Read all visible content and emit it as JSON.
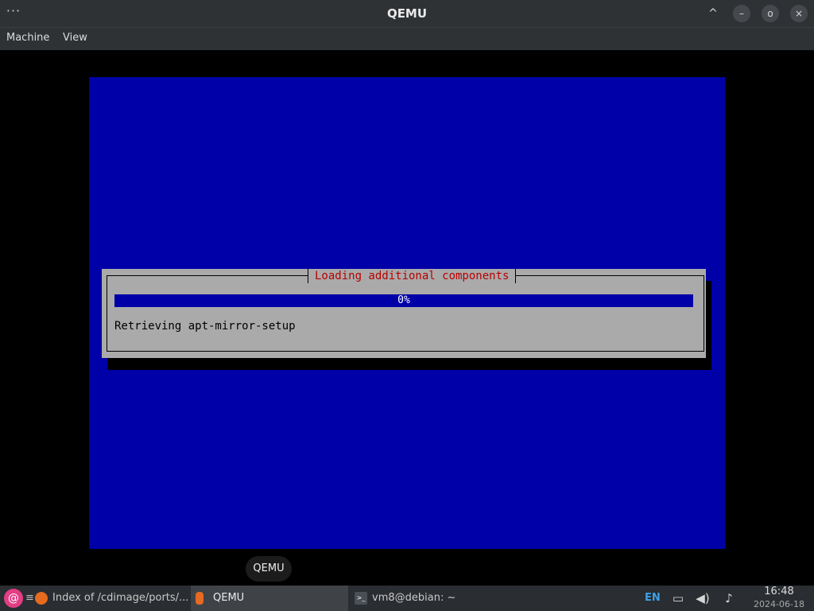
{
  "window": {
    "title": "QEMU",
    "menu_icon": "ellipsis-menu-icon",
    "controls": {
      "collapse_glyph": "^",
      "minimize_glyph": "–",
      "restore_glyph": "o",
      "close_glyph": "×"
    }
  },
  "menubar": {
    "items": [
      {
        "label": "Machine"
      },
      {
        "label": "View"
      }
    ]
  },
  "guest": {
    "background_color": "#0000a8",
    "dialog": {
      "title": "Loading additional components",
      "progress_label": "0%",
      "progress_fraction": 0,
      "status": "Retrieving apt-mirror-setup",
      "title_color": "#b80000",
      "dialog_color": "#aaaaaa"
    }
  },
  "tooltip": {
    "text": "QEMU"
  },
  "taskbar": {
    "start_icon": "debian-swirl-icon",
    "tasks": [
      {
        "label": "Index of /cdimage/ports/...",
        "icon": "firefox-icon"
      },
      {
        "label": "QEMU",
        "icon": "qemu-icon",
        "active": true
      },
      {
        "label": "vm8@debian: ~",
        "icon": "terminal-icon"
      }
    ],
    "tray": {
      "language": "EN",
      "icons": [
        "network-icon",
        "volume-icon",
        "notification-bell-icon"
      ]
    },
    "clock": {
      "time": "16:48",
      "date": "2024-06-18"
    }
  }
}
